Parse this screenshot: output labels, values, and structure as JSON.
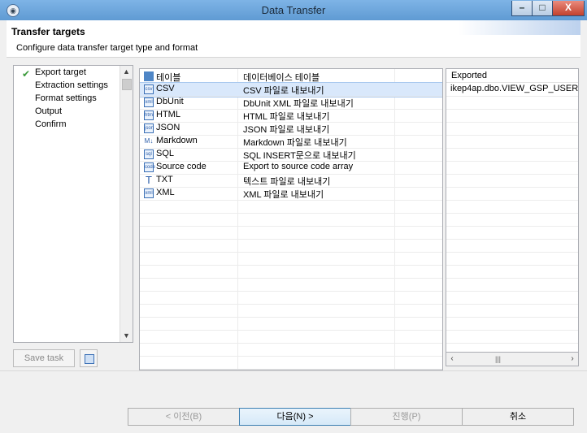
{
  "window": {
    "title": "Data Transfer",
    "min": "–",
    "max": "□",
    "close": "X"
  },
  "header": {
    "title": "Transfer targets",
    "subtitle": "Configure data transfer target type and format"
  },
  "nav": {
    "items": [
      {
        "label": "Export target",
        "checked": true
      },
      {
        "label": "Extraction settings",
        "checked": false
      },
      {
        "label": "Format settings",
        "checked": false
      },
      {
        "label": "Output",
        "checked": false
      },
      {
        "label": "Confirm",
        "checked": false
      }
    ]
  },
  "left_actions": {
    "save_task": "Save task"
  },
  "table": {
    "header": {
      "name": "테이블",
      "description": "데이터베이스 테이블"
    },
    "rows": [
      {
        "name": "CSV",
        "description": "CSV 파일로 내보내기",
        "icon": "csv-icon",
        "selected": true
      },
      {
        "name": "DbUnit",
        "description": "DbUnit XML 파일로 내보내기",
        "icon": "dbunit-icon",
        "selected": false
      },
      {
        "name": "HTML",
        "description": "HTML 파일로 내보내기",
        "icon": "html-icon",
        "selected": false
      },
      {
        "name": "JSON",
        "description": "JSON 파일로 내보내기",
        "icon": "json-icon",
        "selected": false
      },
      {
        "name": "Markdown",
        "description": "Markdown 파일로 내보내기",
        "icon": "markdown-icon",
        "selected": false
      },
      {
        "name": "SQL",
        "description": "SQL INSERT문으로 내보내기",
        "icon": "sql-icon",
        "selected": false
      },
      {
        "name": "Source code",
        "description": "Export to source code array",
        "icon": "source-code-icon",
        "selected": false
      },
      {
        "name": "TXT",
        "description": "텍스트 파일로 내보내기",
        "icon": "txt-icon",
        "selected": false
      },
      {
        "name": "XML",
        "description": "XML 파일로 내보내기",
        "icon": "xml-icon",
        "selected": false
      }
    ]
  },
  "exported": {
    "header": "Exported",
    "items": [
      "ikep4ap.dbo.VIEW_GSP_USER"
    ]
  },
  "footer": {
    "prev": "< 이전(B)",
    "next": "다음(N) >",
    "proceed": "진행(P)",
    "cancel": "취소"
  },
  "colors": {
    "selection": "#d9e8fb",
    "check": "#3a9a3a"
  }
}
